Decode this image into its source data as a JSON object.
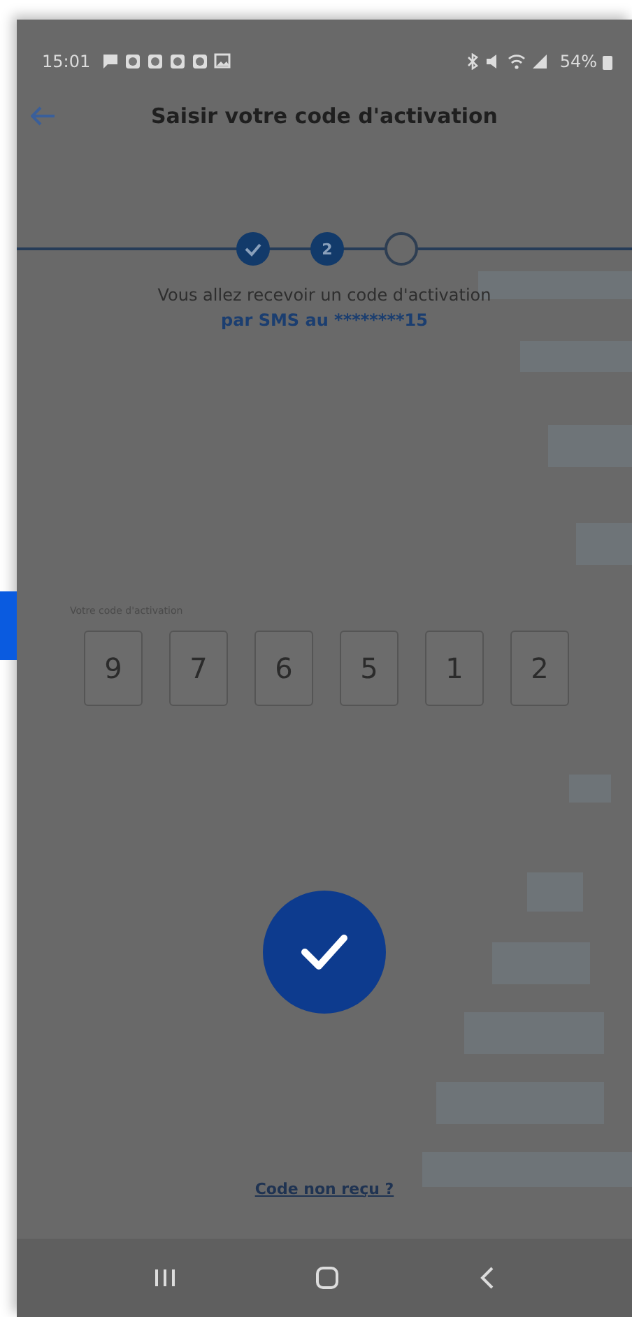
{
  "status_bar": {
    "time": "15:01",
    "battery": "54%"
  },
  "header": {
    "title": "Saisir votre code d'activation"
  },
  "steps": [
    {
      "kind": "done"
    },
    {
      "kind": "current",
      "label": "2"
    },
    {
      "kind": "pending"
    }
  ],
  "message": {
    "line_1": "Vous allez recevoir un code d'activation",
    "line_2": "par SMS au ********15"
  },
  "code": {
    "label": "Votre code d'activation",
    "digits": [
      "9",
      "7",
      "6",
      "5",
      "1",
      "2"
    ]
  },
  "link": "Code non reçu ?"
}
